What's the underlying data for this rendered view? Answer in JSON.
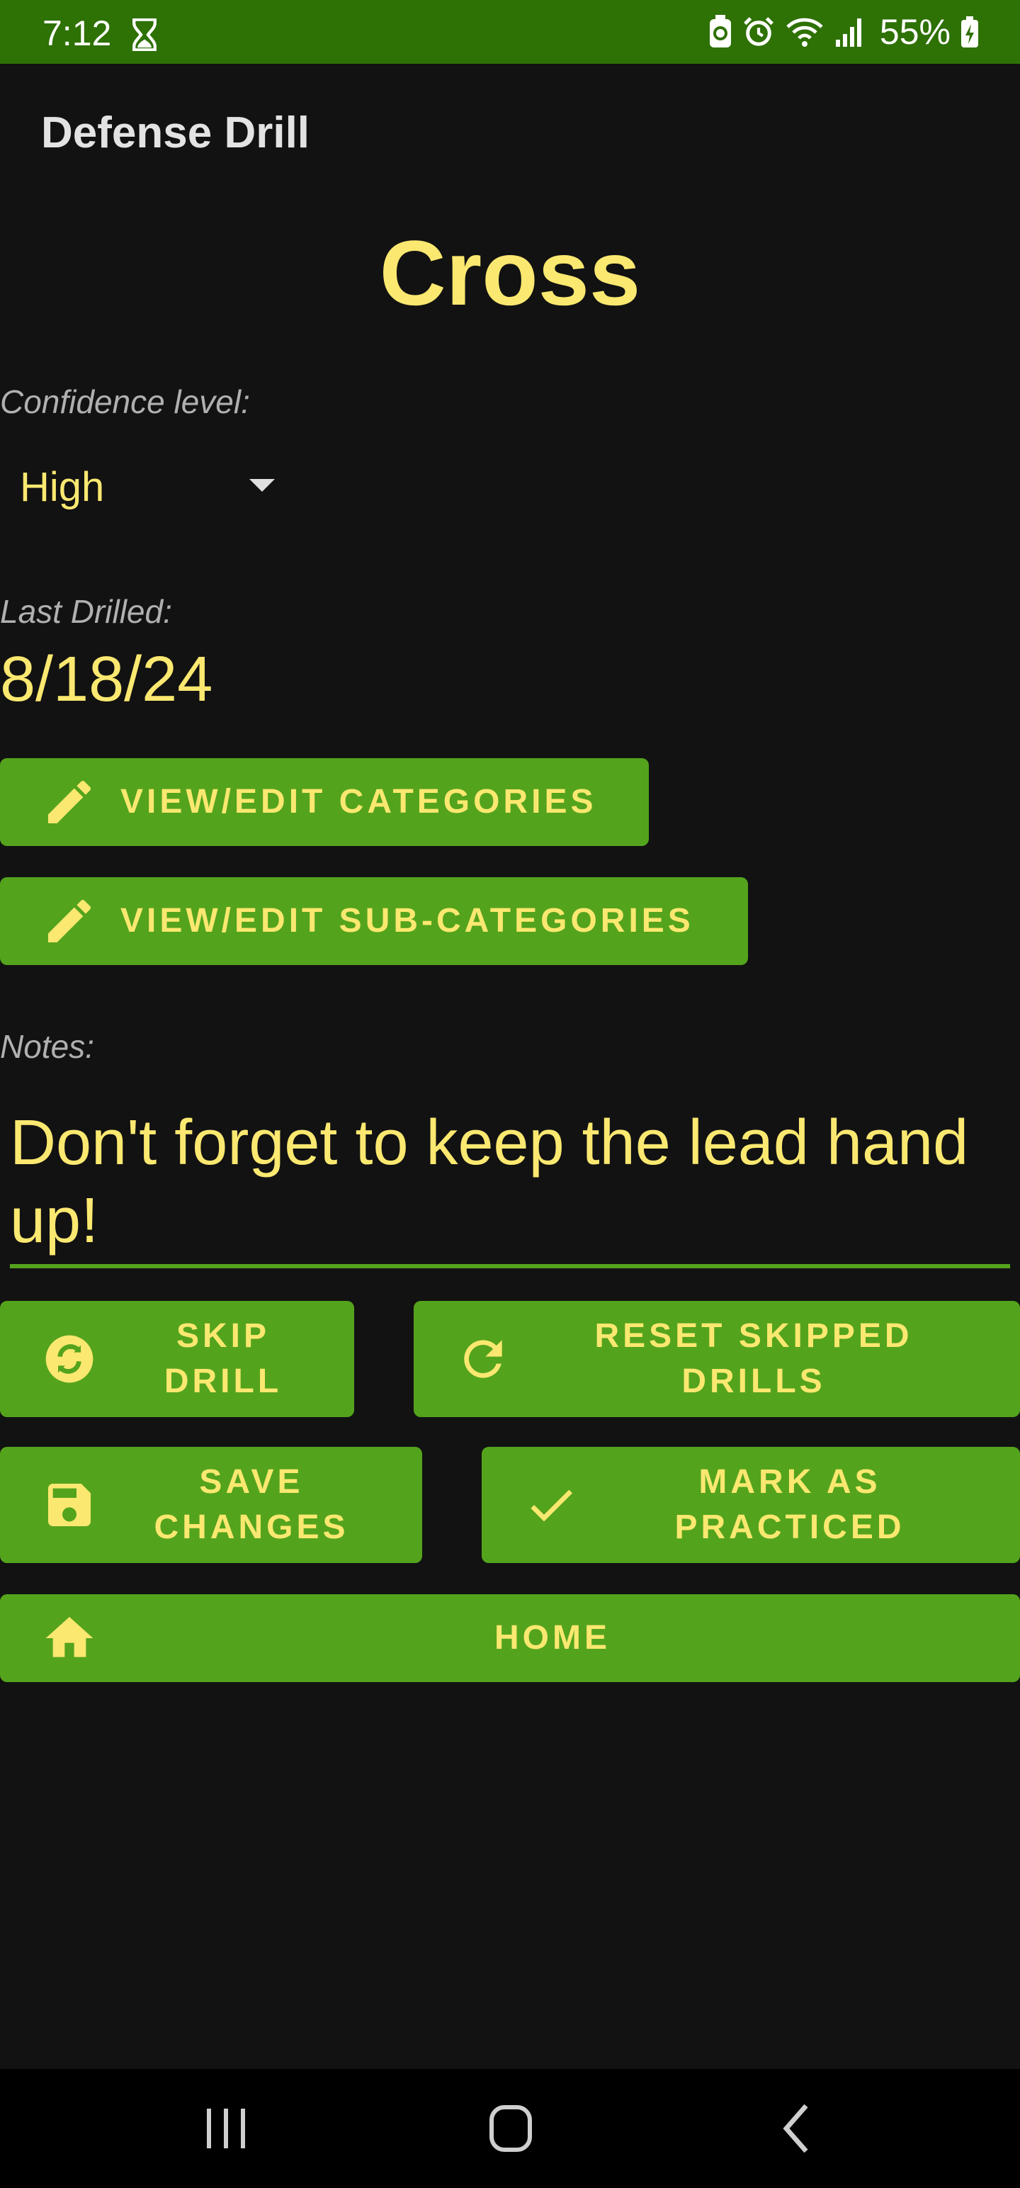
{
  "status_bar": {
    "time": "7:12",
    "battery_percent": "55%",
    "icons": [
      "hourglass-icon",
      "battery-saver-icon",
      "alarm-icon",
      "wifi-icon",
      "signal-icon",
      "battery-charging-icon"
    ]
  },
  "app_bar": {
    "title": "Defense Drill"
  },
  "drill": {
    "name": "Cross"
  },
  "confidence": {
    "label": "Confidence level:",
    "selected": "High"
  },
  "last_drilled": {
    "label": "Last Drilled:",
    "date": "8/18/24"
  },
  "buttons": {
    "edit_categories": {
      "label": "VIEW/EDIT CATEGORIES",
      "icon": "pencil-icon"
    },
    "edit_subcategories": {
      "label": "VIEW/EDIT SUB-CATEGORIES",
      "icon": "pencil-icon"
    },
    "skip_drill": {
      "line1": "SKIP",
      "line2": "DRILL",
      "icon": "skip-cycle-icon"
    },
    "reset_skipped": {
      "line1": "RESET SKIPPED",
      "line2": "DRILLS",
      "icon": "refresh-icon"
    },
    "save_changes": {
      "line1": "SAVE",
      "line2": "CHANGES",
      "icon": "save-icon"
    },
    "mark_practiced": {
      "line1": "MARK AS",
      "line2": "PRACTICED",
      "icon": "check-icon"
    },
    "home": {
      "label": "HOME",
      "icon": "home-icon"
    }
  },
  "notes": {
    "label": "Notes:",
    "value": "Don't forget to keep the lead hand up!"
  },
  "colors": {
    "status_bar": "#2e7104",
    "background": "#121212",
    "accent_green": "#54a31d",
    "text_yellow": "#fbe870"
  },
  "nav_bar": {
    "icons": [
      "recents-icon",
      "home-nav-icon",
      "back-icon"
    ]
  }
}
